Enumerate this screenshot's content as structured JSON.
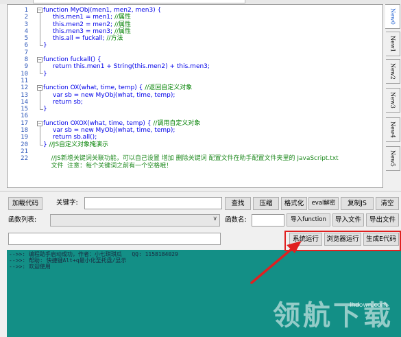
{
  "editor": {
    "line_numbers": [
      "1",
      "2",
      "3",
      "4",
      "5",
      "6",
      "7",
      "8",
      "9",
      "10",
      "11",
      "12",
      "13",
      "14",
      "15",
      "16",
      "17",
      "18",
      "19",
      "20",
      "21",
      "22"
    ],
    "lines": [
      {
        "indent": 0,
        "parts": [
          {
            "t": "function",
            "c": "cb"
          },
          {
            "t": " MyObj(men1, men2, men3) {",
            "c": "cb"
          }
        ]
      },
      {
        "indent": 1,
        "parts": [
          {
            "t": "this",
            "c": "cb"
          },
          {
            "t": ".men1 = men1; ",
            "c": "cb"
          },
          {
            "t": "//属性",
            "c": "cg"
          }
        ]
      },
      {
        "indent": 1,
        "parts": [
          {
            "t": "this",
            "c": "cb"
          },
          {
            "t": ".men2 = men2; ",
            "c": "cb"
          },
          {
            "t": "//属性",
            "c": "cg"
          }
        ]
      },
      {
        "indent": 1,
        "parts": [
          {
            "t": "this",
            "c": "cb"
          },
          {
            "t": ".men3 = men3; ",
            "c": "cb"
          },
          {
            "t": "//属性",
            "c": "cg"
          }
        ]
      },
      {
        "indent": 1,
        "parts": [
          {
            "t": "this",
            "c": "cb"
          },
          {
            "t": ".all = fuckall; ",
            "c": "cb"
          },
          {
            "t": "//方法",
            "c": "cg"
          }
        ]
      },
      {
        "indent": 0,
        "parts": [
          {
            "t": "}",
            "c": "cb"
          }
        ]
      },
      {
        "indent": 0,
        "parts": []
      },
      {
        "indent": 0,
        "parts": [
          {
            "t": "function",
            "c": "cb"
          },
          {
            "t": " fuckall() {",
            "c": "cb"
          }
        ]
      },
      {
        "indent": 1,
        "parts": [
          {
            "t": "return",
            "c": "cb"
          },
          {
            "t": " this",
            "c": "cb"
          },
          {
            "t": ".men1 + String(",
            "c": "cb"
          },
          {
            "t": "this",
            "c": "cb"
          },
          {
            "t": ".men2) + ",
            "c": "cb"
          },
          {
            "t": "this",
            "c": "cb"
          },
          {
            "t": ".men3;",
            "c": "cb"
          }
        ]
      },
      {
        "indent": 0,
        "parts": [
          {
            "t": "}",
            "c": "cb"
          }
        ]
      },
      {
        "indent": 0,
        "parts": []
      },
      {
        "indent": 0,
        "parts": [
          {
            "t": "function",
            "c": "cb"
          },
          {
            "t": " OX(what, time, temp) { ",
            "c": "cb"
          },
          {
            "t": "//返回自定义对象",
            "c": "cg"
          }
        ]
      },
      {
        "indent": 1,
        "parts": [
          {
            "t": "var",
            "c": "cb"
          },
          {
            "t": " sb = ",
            "c": "cb"
          },
          {
            "t": "new",
            "c": "cb"
          },
          {
            "t": " MyObj(what, time, temp);",
            "c": "cb"
          }
        ]
      },
      {
        "indent": 1,
        "parts": [
          {
            "t": "return",
            "c": "cb"
          },
          {
            "t": " sb;",
            "c": "cb"
          }
        ]
      },
      {
        "indent": 0,
        "parts": [
          {
            "t": "}",
            "c": "cb"
          }
        ]
      },
      {
        "indent": 0,
        "parts": []
      },
      {
        "indent": 0,
        "parts": [
          {
            "t": "function",
            "c": "cb"
          },
          {
            "t": " OXOX(what, time, temp) { ",
            "c": "cb"
          },
          {
            "t": "//调用自定义对象",
            "c": "cg"
          }
        ]
      },
      {
        "indent": 1,
        "parts": [
          {
            "t": "var",
            "c": "cb"
          },
          {
            "t": " sb = ",
            "c": "cb"
          },
          {
            "t": "new",
            "c": "cb"
          },
          {
            "t": " MyObj(what, time, temp);",
            "c": "cb"
          }
        ]
      },
      {
        "indent": 1,
        "parts": [
          {
            "t": "return",
            "c": "cb"
          },
          {
            "t": " sb.all();",
            "c": "cb"
          }
        ]
      },
      {
        "indent": 0,
        "parts": [
          {
            "t": "} ",
            "c": "cb"
          },
          {
            "t": "//JS自定义对象掩演示",
            "c": "cg"
          }
        ]
      },
      {
        "indent": 0,
        "parts": []
      },
      {
        "indent": 0,
        "parts": [
          {
            "t": "    //JS新增关键词关联功能，可以自己设置 增加 删除关键词 配置文件在助手配置文件夹里的 JavaScript.txt",
            "c": "cm"
          }
        ]
      },
      {
        "indent": 0,
        "parts": [
          {
            "t": "    文件  注意：每个关键词之前有一个空格哦！",
            "c": "cm"
          }
        ]
      }
    ]
  },
  "tabs": [
    "New0",
    "New1",
    "New2",
    "New3",
    "New4",
    "New5"
  ],
  "toolbar1": {
    "load_code": "加载代码",
    "keyword_label": "关键字:",
    "find": "查找",
    "compress": "压缩",
    "format": "格式化",
    "eval_decrypt": "eval解密",
    "copy_js": "复制JS",
    "clear": "清空"
  },
  "toolbar2": {
    "function_list_label": "函数列表:",
    "function_name_label": "函数名:",
    "import_function": "导入function",
    "import_file": "导入文件",
    "export_file": "导出文件"
  },
  "toolbar3": {
    "system_run": "系统运行",
    "browser_run": "浏览器运行",
    "generate_e_code": "生成E代码"
  },
  "console": {
    "lines": [
      "-->>: 编程助手启动成功，作者：小七琪琪瓜   QQ: 1158184029",
      "-->>: 帮助: 快捷键Alt+q最小化至托盘/显示",
      "-->>: 欢迎使用"
    ]
  },
  "watermark": {
    "text": "领航下载",
    "url": "lhdown.com"
  },
  "colors": {
    "console_bg": "#138f86",
    "highlight": "#e02020",
    "keyword": "#0000e8",
    "comment": "#008000"
  }
}
